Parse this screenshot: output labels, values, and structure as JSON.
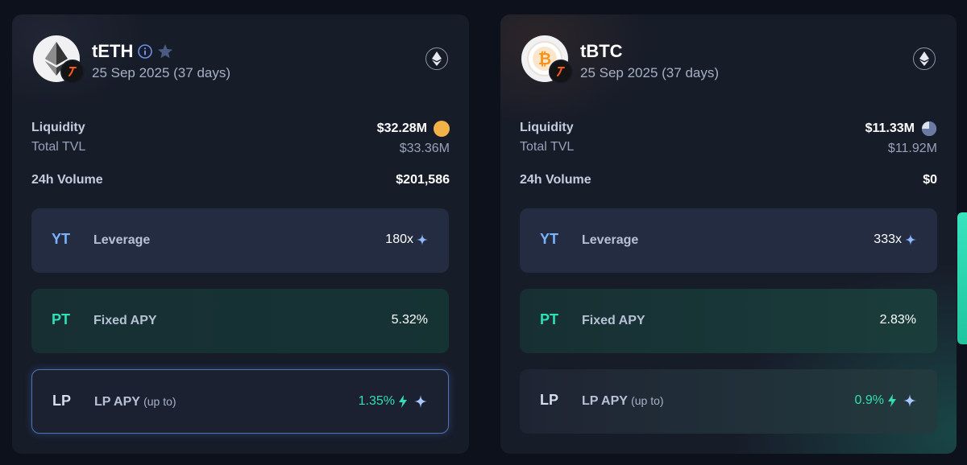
{
  "cards": [
    {
      "name": "tETH",
      "date": "25 Sep 2025 (37 days)",
      "liquidity_label": "Liquidity",
      "liquidity_value": "$32.28M",
      "tvl_label": "Total TVL",
      "tvl_value": "$33.36M",
      "volume_label": "24h Volume",
      "volume_value": "$201,586",
      "yt_tag": "YT",
      "yt_label": "Leverage",
      "yt_value": "180x",
      "pt_tag": "PT",
      "pt_label": "Fixed APY",
      "pt_value": "5.32%",
      "lp_tag": "LP",
      "lp_label": "LP APY",
      "lp_label_small": "(up to)",
      "lp_value": "1.35%",
      "asset_icon": "ethereum-icon",
      "chain_icon": "ethereum-chain-icon",
      "liquidity_indicator": "gold-coin-icon"
    },
    {
      "name": "tBTC",
      "date": "25 Sep 2025 (37 days)",
      "liquidity_label": "Liquidity",
      "liquidity_value": "$11.33M",
      "tvl_label": "Total TVL",
      "tvl_value": "$11.92M",
      "volume_label": "24h Volume",
      "volume_value": "$0",
      "yt_tag": "YT",
      "yt_label": "Leverage",
      "yt_value": "333x",
      "pt_tag": "PT",
      "pt_label": "Fixed APY",
      "pt_value": "2.83%",
      "lp_tag": "LP",
      "lp_label": "LP APY",
      "lp_label_small": "(up to)",
      "lp_value": "0.9%",
      "asset_icon": "bitcoin-icon",
      "chain_icon": "ethereum-chain-icon",
      "liquidity_indicator": "pie-indicator-icon"
    }
  ],
  "colors": {
    "background": "#0d111c",
    "card": "#171c29",
    "yt_accent": "#7ab4ff",
    "pt_accent": "#2ee0b6",
    "lp_value": "#33dfb0",
    "coin": "#f2b24a",
    "bitcoin": "#f7931a"
  }
}
